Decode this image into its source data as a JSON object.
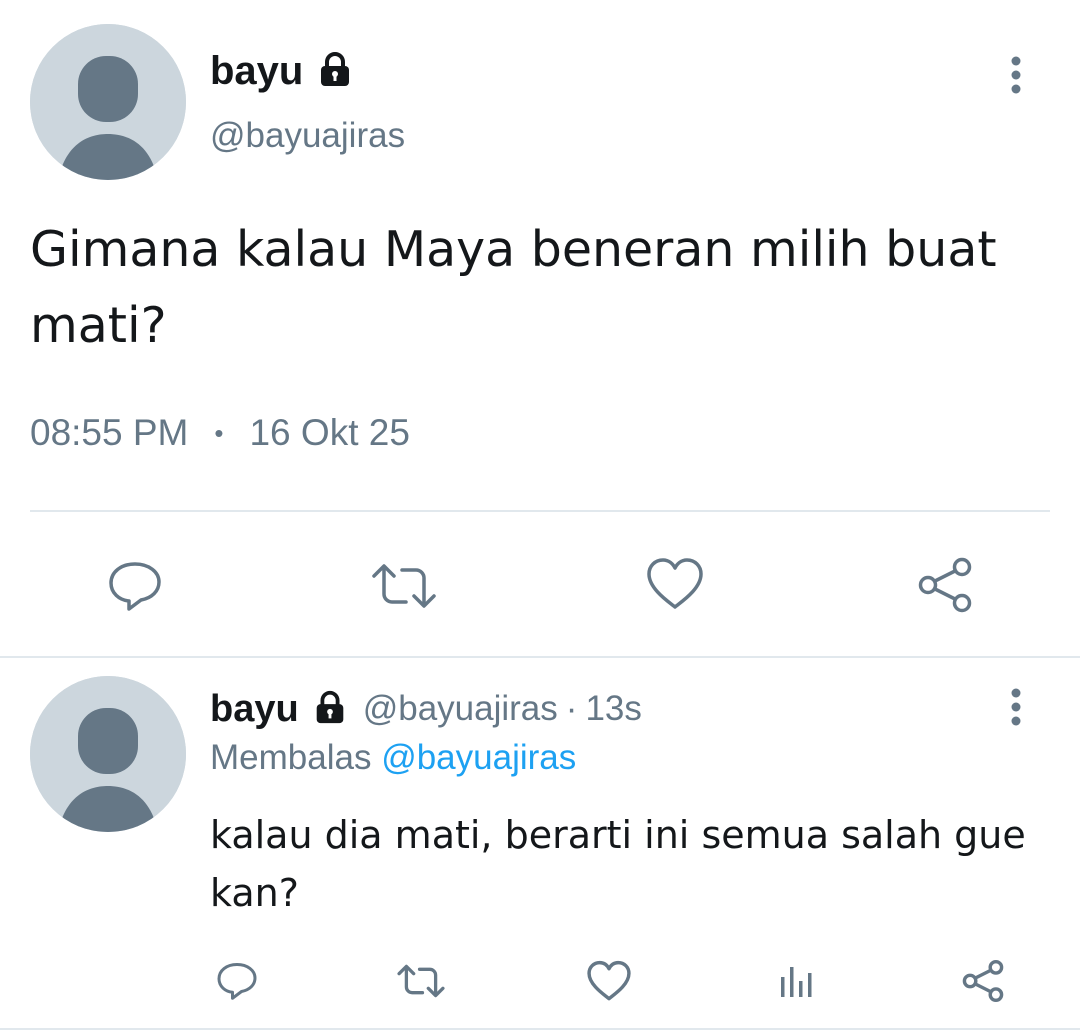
{
  "main_tweet": {
    "author_name": "bayu",
    "handle": "@bayuajiras",
    "text_line1": "Gimana kalau Maya beneran milih buat",
    "text_line2": "mati?",
    "time": "08:55 PM",
    "separator": "•",
    "date": "16 Okt 25",
    "icons": {
      "protected": "lock-icon",
      "more": "more-vertical-icon",
      "reply": "reply-icon",
      "retweet": "retweet-icon",
      "like": "heart-icon",
      "share": "share-icon"
    }
  },
  "reply_tweet": {
    "author_name": "bayu",
    "handle": "@bayuajiras",
    "dot": "·",
    "age": "13s",
    "replying_label": "Membalas",
    "replying_to": "@bayuajiras",
    "text_line1": "kalau dia mati, berarti ini semua salah gue",
    "text_line2": "kan?",
    "icons": {
      "protected": "lock-icon",
      "more": "more-vertical-icon",
      "reply": "reply-icon",
      "retweet": "retweet-icon",
      "like": "heart-icon",
      "analytics": "analytics-icon",
      "share": "share-icon"
    }
  },
  "colors": {
    "text": "#14171a",
    "muted": "#657786",
    "link": "#1da1f2",
    "divider": "#e1e8ed",
    "avatar_bg": "#ccd6dd",
    "avatar_fg": "#657786"
  }
}
